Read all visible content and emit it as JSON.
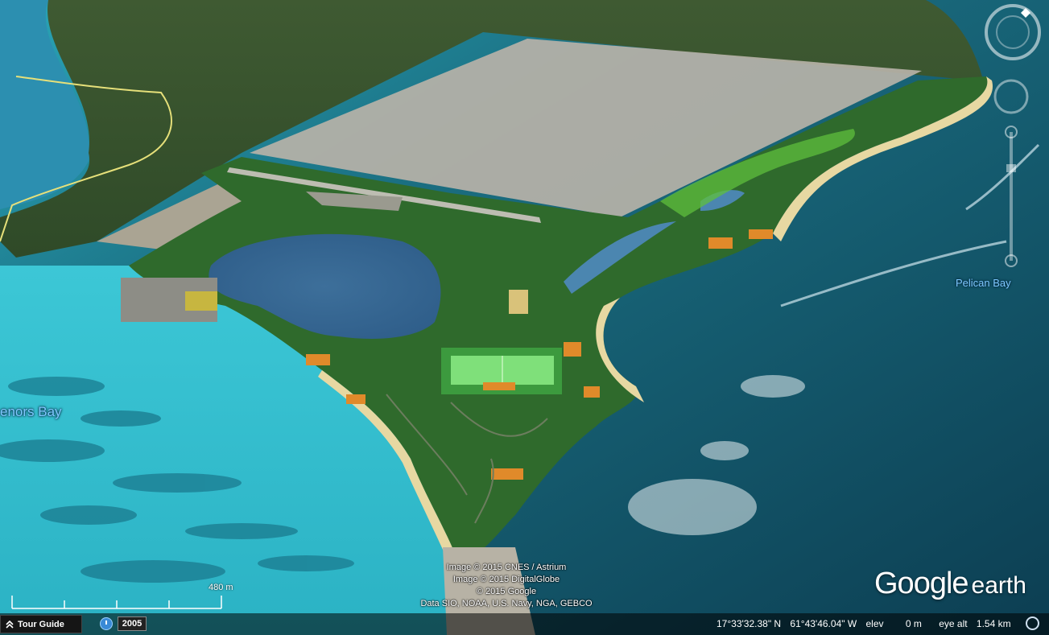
{
  "labels": {
    "pelican_bay": "Pelican Bay",
    "tenors_bay": "enors Bay"
  },
  "attribution": {
    "line1": "Image © 2015 CNES / Astrium",
    "line2": "Image © 2015 DigitalGlobe",
    "line3": "© 2015 Google",
    "line4": "Data SIO, NOAA, U.S. Navy, NGA, GEBCO"
  },
  "logo": {
    "google": "Google",
    "earth": "earth"
  },
  "scale": {
    "label": "480 m"
  },
  "status": {
    "tour_guide": "Tour Guide",
    "year": "2005",
    "latitude": "17°33'32.38\" N",
    "longitude": "61°43'46.04\" W",
    "elev_label": "elev",
    "elev_value": "0 m",
    "eye_alt_label": "eye alt",
    "eye_alt_value": "1.54 km"
  },
  "icons": {
    "tour": "chevron-up-icon",
    "clock": "clock-icon",
    "eye": "circle-icon",
    "north": "north-arrow-icon"
  }
}
